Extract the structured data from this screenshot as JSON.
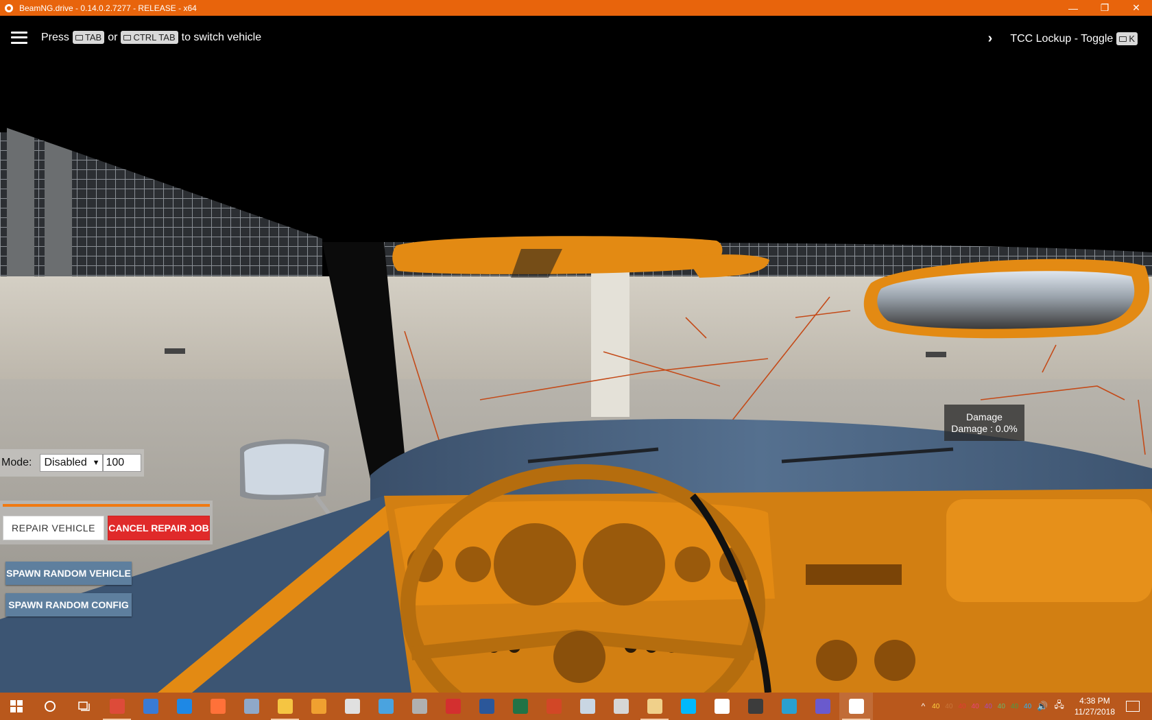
{
  "window": {
    "title": "BeamNG.drive - 0.14.0.2.7277 - RELEASE - x64",
    "controls": {
      "minimize": "—",
      "restore": "❐",
      "close": "✕"
    }
  },
  "hud": {
    "switch_hint": {
      "prefix": "Press",
      "key1": "TAB",
      "or": "or",
      "key2": "CTRL TAB",
      "suffix": "to switch vehicle"
    },
    "tcc_label": "TCC Lockup - Toggle",
    "tcc_key": "K"
  },
  "damage": {
    "title": "Damage",
    "value": "Damage : 0.0%"
  },
  "mode_panel": {
    "label": "Mode:",
    "selected": "Disabled",
    "value": "100"
  },
  "repair_panel": {
    "progress": 1.0,
    "repair_label": "REPAIR VEHICLE",
    "cancel_label": "CANCEL REPAIR JOB"
  },
  "spawn": {
    "vehicle_label": "SPAWN RANDOM VEHICLE",
    "config_label": "SPAWN RANDOM CONFIG"
  },
  "colors": {
    "accent": "#e8640c",
    "taskbar": "#b9581c",
    "cancel": "#e02a2a",
    "spawn": "#5e7f9e",
    "interior": "#e38a13"
  },
  "taskbar": {
    "apps": [
      {
        "name": "chrome-icon",
        "color": "#dd4b39",
        "running": true
      },
      {
        "name": "folder-sync-icon",
        "color": "#3a7bd5",
        "running": false
      },
      {
        "name": "edge-icon",
        "color": "#1e88e5",
        "running": false
      },
      {
        "name": "firefox-icon",
        "color": "#ff7139",
        "running": false
      },
      {
        "name": "photos-icon",
        "color": "#8fa8c8",
        "running": false
      },
      {
        "name": "file-explorer-icon",
        "color": "#f5c542",
        "running": true
      },
      {
        "name": "media-player-icon",
        "color": "#f0a030",
        "running": false
      },
      {
        "name": "calculator-icon",
        "color": "#e0e0e0",
        "running": false
      },
      {
        "name": "control-panel-icon",
        "color": "#4aa3df",
        "running": false
      },
      {
        "name": "disc-icon",
        "color": "#b0b0b0",
        "running": false
      },
      {
        "name": "racing-game-icon",
        "color": "#d32f2f",
        "running": false
      },
      {
        "name": "word-icon",
        "color": "#2b579a",
        "running": false
      },
      {
        "name": "excel-icon",
        "color": "#217346",
        "running": false
      },
      {
        "name": "powerpoint-icon",
        "color": "#d24726",
        "running": false
      },
      {
        "name": "paint-icon",
        "color": "#c9d6e3",
        "running": false
      },
      {
        "name": "3d-viewer-icon",
        "color": "#d6d6d6",
        "running": false
      },
      {
        "name": "beamng-launcher-icon",
        "color": "#f0d08a",
        "running": true
      },
      {
        "name": "logitech-icon",
        "color": "#00b8fc",
        "running": false
      },
      {
        "name": "audio-wave-icon",
        "color": "#ffffff",
        "running": false
      },
      {
        "name": "settings-tool-icon",
        "color": "#3c3c3c",
        "running": false
      },
      {
        "name": "game-cube-icon",
        "color": "#2aa0d0",
        "running": false
      },
      {
        "name": "globe-icon",
        "color": "#6a5acd",
        "running": false
      },
      {
        "name": "beamng-drive-icon",
        "color": "#ffffff",
        "running": true
      }
    ],
    "tray": {
      "up_arrow": "^",
      "numbers": [
        {
          "value": "40",
          "color": "#ffd23f"
        },
        {
          "value": "40",
          "color": "#c9763a"
        },
        {
          "value": "40",
          "color": "#e53935"
        },
        {
          "value": "40",
          "color": "#ec407a"
        },
        {
          "value": "40",
          "color": "#ab47bc"
        },
        {
          "value": "40",
          "color": "#66bb6a"
        },
        {
          "value": "40",
          "color": "#43a047"
        },
        {
          "value": "40",
          "color": "#29b6f6"
        }
      ],
      "volume": "🔊",
      "network": "🖧",
      "time": "4:38 PM",
      "date": "11/27/2018"
    }
  }
}
